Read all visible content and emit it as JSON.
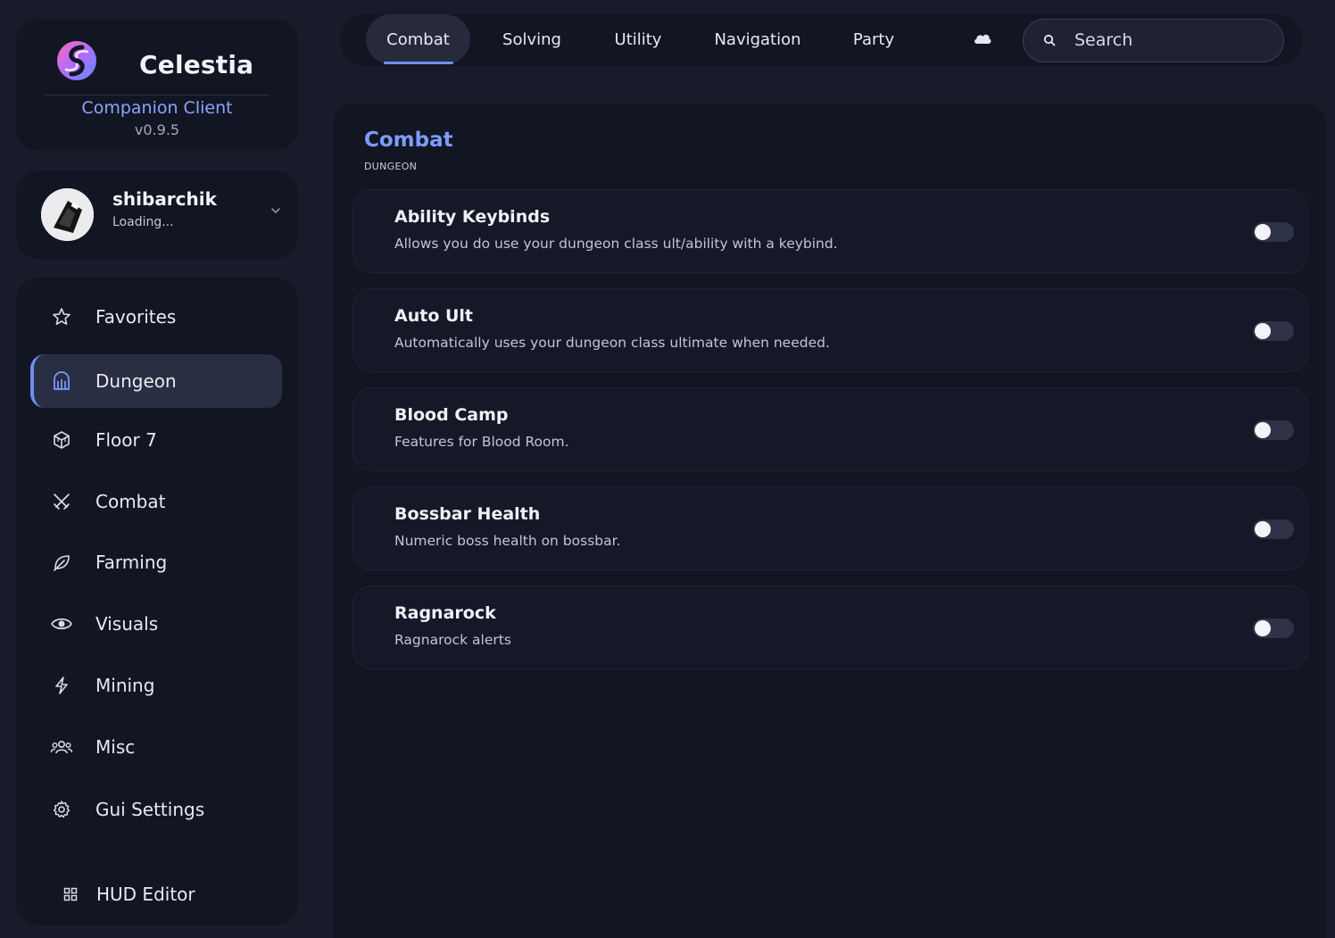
{
  "brand": {
    "name": "Celestia",
    "subtitle": "Companion Client",
    "version": "v0.9.5"
  },
  "user": {
    "name": "shibarchik",
    "status": "Loading..."
  },
  "sidebar": {
    "items": [
      {
        "label": "Favorites",
        "icon": "star-icon"
      },
      {
        "label": "Dungeon",
        "icon": "archway-icon",
        "active": true
      },
      {
        "label": "Floor 7",
        "icon": "cube-icon"
      },
      {
        "label": "Combat",
        "icon": "crossed-swords-icon"
      },
      {
        "label": "Farming",
        "icon": "leaf-icon"
      },
      {
        "label": "Visuals",
        "icon": "eye-icon"
      },
      {
        "label": "Mining",
        "icon": "lightning-icon"
      },
      {
        "label": "Misc",
        "icon": "users-icon"
      },
      {
        "label": "Gui Settings",
        "icon": "gear-icon"
      }
    ],
    "hud_editor": "HUD Editor"
  },
  "tabs": [
    {
      "label": "Combat",
      "active": true
    },
    {
      "label": "Solving"
    },
    {
      "label": "Utility"
    },
    {
      "label": "Navigation"
    },
    {
      "label": "Party"
    }
  ],
  "search": {
    "placeholder": "Search",
    "value": ""
  },
  "main": {
    "title": "Combat",
    "subtitle": "DUNGEON",
    "features": [
      {
        "name": "Ability Keybinds",
        "description": "Allows you do use your dungeon class ult/ability with a keybind.",
        "enabled": false
      },
      {
        "name": "Auto Ult",
        "description": "Automatically uses your dungeon class ultimate when needed.",
        "enabled": false
      },
      {
        "name": "Blood Camp",
        "description": "Features for Blood Room.",
        "enabled": false
      },
      {
        "name": "Bossbar Health",
        "description": "Numeric boss health on bossbar.",
        "enabled": false
      },
      {
        "name": "Ragnarock",
        "description": "Ragnarock alerts",
        "enabled": false
      }
    ]
  },
  "colors": {
    "accent": "#7e9cff",
    "background": "#181b2a",
    "panel": "#121522"
  }
}
